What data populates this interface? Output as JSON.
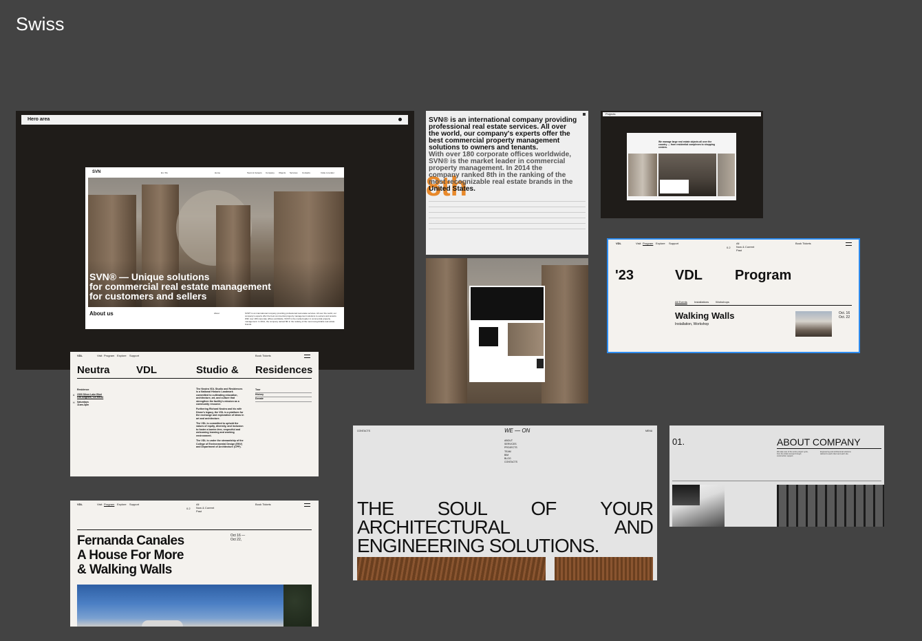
{
  "board": {
    "title": "Swiss"
  },
  "hero": {
    "bar_label": "Hero area",
    "site_logo": "SVN",
    "lang": "En / Ru",
    "nav": [
      "Home",
      "Team & Careers",
      "Company",
      "Objects",
      "Services",
      "Contacts"
    ],
    "cta": "Invite to tender",
    "headline": [
      "SVN® — Unique solutions",
      "for commercial real estate management",
      "for customers and sellers"
    ],
    "about_title": "About us",
    "about_label": "About",
    "about_text": "SVN® is an international company providing professional real estate services. All over the world, our company's experts offer the best commercial property management solutions to owners and tenants. With over 180 corporate offices worldwide, SVN® is the market leader in commercial property management. In 2014, the company ranked 8th in the ranking of the most recognizable real estate brands."
  },
  "svn_about": {
    "paragraph": [
      "SVN® is an international company providing",
      "professional real estate services. All over",
      "the world, our company's experts offer the",
      "best commercial property management",
      "solutions to owners and tenants.",
      "With over 180 corporate offices worldwide,",
      "SVN® is the market leader in commercial",
      "property management. In 2014 the",
      "company ranked 8th in the ranking of the",
      "most recognizable real estate brands in the",
      "United States."
    ],
    "big_number": "8th"
  },
  "projects": {
    "bar_label": "Projects",
    "tagline": "We manage large real estate objects all over the country — from residential complexes to shopping centers."
  },
  "vdl_program": {
    "logo": "VDL",
    "nav": [
      "Visit",
      "Program",
      "Explore",
      "Support"
    ],
    "filter_num": "0.2",
    "filters": [
      "All",
      "Now & Current",
      "Past"
    ],
    "book": "Book Tickets",
    "year": "'23",
    "brand": "VDL",
    "title": "Program",
    "tabs": [
      "All Events",
      "Installations",
      "Workshops"
    ],
    "event_title": "Walking Walls",
    "event_sub": "Installation, Workshop",
    "event_dates": [
      "Oct. 16",
      "Oct. 22"
    ]
  },
  "neutra": {
    "logo": "VDL",
    "nav": [
      "Visit",
      "Program",
      "Explore",
      "Support"
    ],
    "book": "Book Tickets",
    "headings": [
      "Neutra",
      "VDL",
      "Studio &",
      "Residences"
    ],
    "residence_label": "Residence",
    "address_marker": "A",
    "address": [
      "2300 Silver Lake Blvd",
      "Los Angeles, CA 90039"
    ],
    "hours_marker": "H",
    "hours": [
      "Saturdays",
      "11am-3pm"
    ],
    "body": [
      "The Neutra VDL Studio and Residences is a National Historic Landmark committed to cultivating education, architecture, art, and culture that strengthen the facility's mission as a community resource.",
      "Furthering Richard Neutra and his wife Dione's legacy, the VDL is a platform for the exchange and exploration of ideas in art and architecture.",
      "The VDL is committed to uphold the values of equity, diversity, and inclusion to foster a barrier-free, respectful and welcoming learning and working environment.",
      "The VDL is under the stewardship of the College of Environmental Design (ENV) and Department of Architecture (CPP)."
    ],
    "links": [
      "Tour",
      "History",
      "Donate"
    ]
  },
  "fernanda": {
    "logo": "VDL",
    "nav": [
      "Visit",
      "Program",
      "Explore",
      "Support"
    ],
    "filter_num": "0.2",
    "filters": [
      "All",
      "Now & Current",
      "Past"
    ],
    "book": "Book Tickets",
    "title": [
      "Fernanda Canales",
      "A House For More",
      "& Walking Walls"
    ],
    "dates": [
      "Oct 16 —",
      "Oct 22,"
    ]
  },
  "weon": {
    "contacts": "CONTACTS",
    "logo": "WE — ON",
    "menu_label": "MENU",
    "menu": [
      "ABOUT",
      "SERVICES",
      "PROJECTS",
      "TEAM",
      "BIM",
      "BLOG",
      "CONTACTS"
    ],
    "headline": {
      "row1": [
        "THE",
        "SOUL",
        "OF",
        "YOUR"
      ],
      "row2": [
        "ARCHITECTURAL",
        "AND"
      ],
      "row3": "ENGINEERING SOLUTIONS."
    }
  },
  "about_company": {
    "number": "01.",
    "title": "ABOUT COMPANY",
    "col1": "We take care of the entire project cycle, from the initial concept through construction support.",
    "col2": "Engineering and architectural solutions tailored to each client and each site."
  },
  "colors": {
    "background": "#434343",
    "dark_panel": "#1f1c19",
    "accent_orange": "#e8892b",
    "selection_blue": "#2d8cf0"
  }
}
